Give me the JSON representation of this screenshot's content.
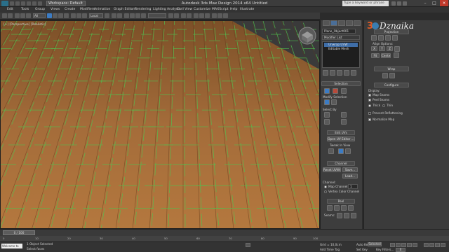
{
  "titlebar": {
    "workspace": "Workspace: Default",
    "title": "Autodesk 3ds Max Design 2014 x64      Untitled",
    "search_placeholder": "Type a keyword or phrase"
  },
  "menu": [
    "Edit",
    "Tools",
    "Group",
    "Views",
    "Create",
    "Modifiers",
    "Animation",
    "Graph Editors",
    "Rendering",
    "Lighting Analysis",
    "Civil View",
    "Customize",
    "MAXScript",
    "Help",
    "Illustrate"
  ],
  "toolbar": {
    "filter": "All",
    "ref_coord": "Local",
    "selection_set": ""
  },
  "viewport": {
    "label": "[+] [Perspective] [Realistic]"
  },
  "modify_panel": {
    "object_name": "Plane_Object001",
    "modifier_list": "Modifier List",
    "stack": [
      {
        "label": "Unwrap UVW",
        "active": true
      },
      {
        "label": "Editable Mesh",
        "active": false
      }
    ]
  },
  "unwrap_panel": {
    "logo_text": "Dznaika",
    "projection": {
      "title": "Projection",
      "align_options": "Align Options:",
      "x": "X",
      "y": "Y",
      "z": "Z",
      "fit": "Fit",
      "center": "Center"
    },
    "wrap": {
      "title": "Wrap"
    },
    "configure": {
      "title": "Configure",
      "display": "Display:",
      "map_seams": "Map Seams",
      "peel_seams": "Peel Seams",
      "thick": "Thick",
      "thin": "Thin",
      "prevent_reflattening": "Prevent Reflattening",
      "normalize_map": "Normalize Map"
    }
  },
  "rollouts": {
    "selection": {
      "title": "Selection",
      "modify_selection": "Modify Selection",
      "select_by": "Select By"
    },
    "edit_uvs": {
      "title": "Edit UVs",
      "open_uv_editor": "Open UV Editor ...",
      "tweak_in_view": "Tweak In View"
    },
    "channel": {
      "title": "Channel",
      "reset_uvws": "Reset UVWs",
      "save": "Save...",
      "load": "Load...",
      "channel_label": "Channel:",
      "map_channel": "Map Channel:",
      "map_channel_value": "1",
      "vertex_color_channel": "Vertex Color Channel"
    },
    "peel": {
      "title": "Peel",
      "seams": "Seams:"
    }
  },
  "timeline": {
    "slider": "0 / 100",
    "ticks": [
      "0",
      "10",
      "20",
      "30",
      "40",
      "50",
      "60",
      "70",
      "80",
      "90",
      "100"
    ]
  },
  "status": {
    "maxscript": "Welcome to",
    "selected": "1 Object Selected",
    "prompt": "Select faces",
    "grid": "Grid = 10,0cm",
    "add_time_tag": "Add Time Tag",
    "auto_key": "Auto Key",
    "auto_key_value": "Selected",
    "set_key": "Set Key",
    "key_filters": "Key Filters...",
    "frame": "0"
  },
  "colors": {
    "accent": "#3c7cc4",
    "wood_base": "#a06a38",
    "seam_green": "#4fc24f",
    "panel_bg": "#3b3b3b"
  },
  "icons": [
    "app-icon",
    "teapot-icon",
    "viewcube-icon",
    "lock-icon",
    "play-icon",
    "key-icon",
    "pin-icon",
    "trash-icon"
  ]
}
